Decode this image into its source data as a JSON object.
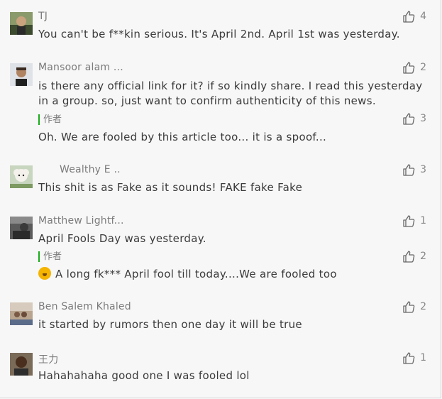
{
  "comments": [
    {
      "name": "TJ",
      "likes": "4",
      "text": "You can't be f**kin serious. It's April 2nd. April 1st was yesterday."
    },
    {
      "name": "Mansoor alam ...",
      "likes": "2",
      "text_line1": "is there any official link for it? if so kindly share. I read this yesterday",
      "text_line2": "in a group. so, just want to confirm authenticity of this news.",
      "reply": {
        "author": "作者",
        "likes": "3",
        "text": "Oh. We are fooled by this article too... it is a spoof..."
      }
    },
    {
      "name": "Wealthy E    ..",
      "likes": "3",
      "text": "This shit is as Fake as it sounds!  FAKE fake Fake"
    },
    {
      "name": "Matthew Lightf...",
      "likes": "1",
      "text": "April Fools Day was yesterday.",
      "reply": {
        "author": "作者",
        "likes": "2",
        "text": "A long fk*** April fool till today....We are fooled too"
      }
    },
    {
      "name": "Ben Salem Khaled",
      "likes": "2",
      "text": "it started by rumors then one day it will be true"
    },
    {
      "name": "王力",
      "likes": "1",
      "text": "Hahahahaha good one I was fooled lol"
    }
  ],
  "icons": {
    "like": "thumbs-up-icon",
    "emoji": "laughing-tears-emoji-icon"
  },
  "colors": {
    "author_bar": "#1aad19",
    "name_text": "#7b7b7b",
    "body_text": "#3a3a3a"
  }
}
